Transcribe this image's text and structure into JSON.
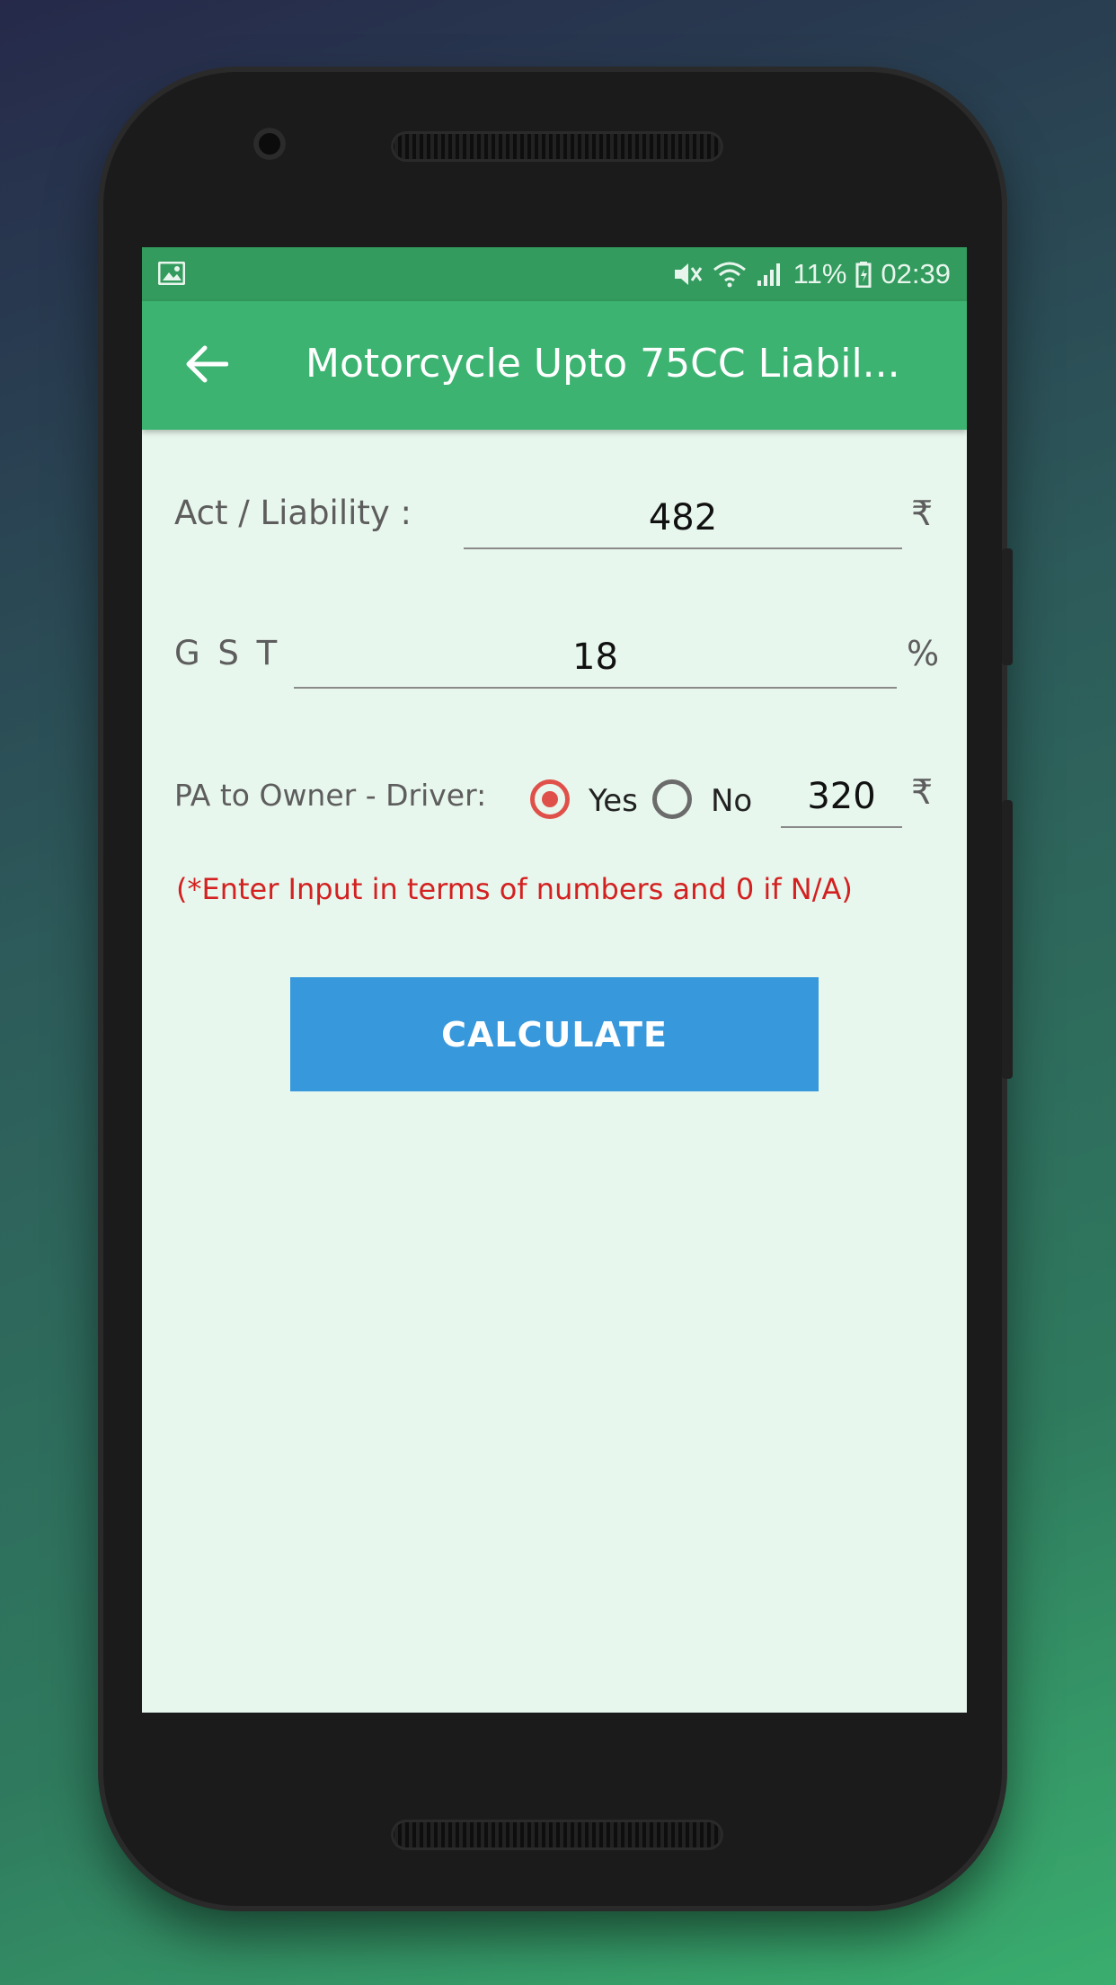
{
  "status_bar": {
    "battery": "11%",
    "time": "02:39",
    "icons": [
      "image-icon",
      "mute-icon",
      "wifi-icon",
      "signal-icon",
      "battery-icon"
    ]
  },
  "app_bar": {
    "title": "Motorcycle Upto 75CC Liabil...",
    "back_icon": "arrow-left-icon"
  },
  "form": {
    "act_label": "Act / Liability :",
    "act_value": "482",
    "act_unit": "₹",
    "gst_label": "G S T",
    "gst_value": "18",
    "gst_unit": "%",
    "pa_label": "PA to Owner - Driver:",
    "pa_yes": "Yes",
    "pa_no": "No",
    "pa_selected": "Yes",
    "pa_value": "320",
    "pa_unit": "₹",
    "note": "(*Enter Input in terms of numbers and 0 if N/A)",
    "calculate": "CALCULATE"
  },
  "colors": {
    "status_bar": "#339b5e",
    "app_bar": "#3cb371",
    "screen_bg": "#e8f7ed",
    "button": "#3898dc",
    "radio_selected": "#e0504a",
    "note": "#d32121"
  }
}
